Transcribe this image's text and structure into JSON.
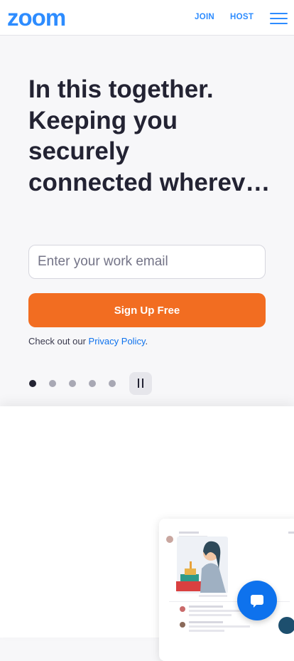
{
  "header": {
    "logo_text": "zoom",
    "join_label": "JOIN",
    "host_label": "HOST",
    "menu_icon": "hamburger-menu-icon"
  },
  "hero": {
    "title_lines": [
      "In this together.",
      "Keeping you",
      "securely",
      "connected wherev…"
    ],
    "email_placeholder": "Enter your work email",
    "signup_label": "Sign Up Free",
    "privacy_prefix": "Check out our ",
    "privacy_link": "Privacy Policy",
    "privacy_suffix": "."
  },
  "carousel": {
    "slide_count": 5,
    "active_slide": 1,
    "pause_icon": "pause-icon"
  },
  "colors": {
    "brand_blue": "#2d8cff",
    "signup_orange": "#f26d21",
    "link_blue": "#0e72ed",
    "title_dark": "#232333"
  },
  "chat_button": {
    "icon": "chat-bubble-icon"
  }
}
